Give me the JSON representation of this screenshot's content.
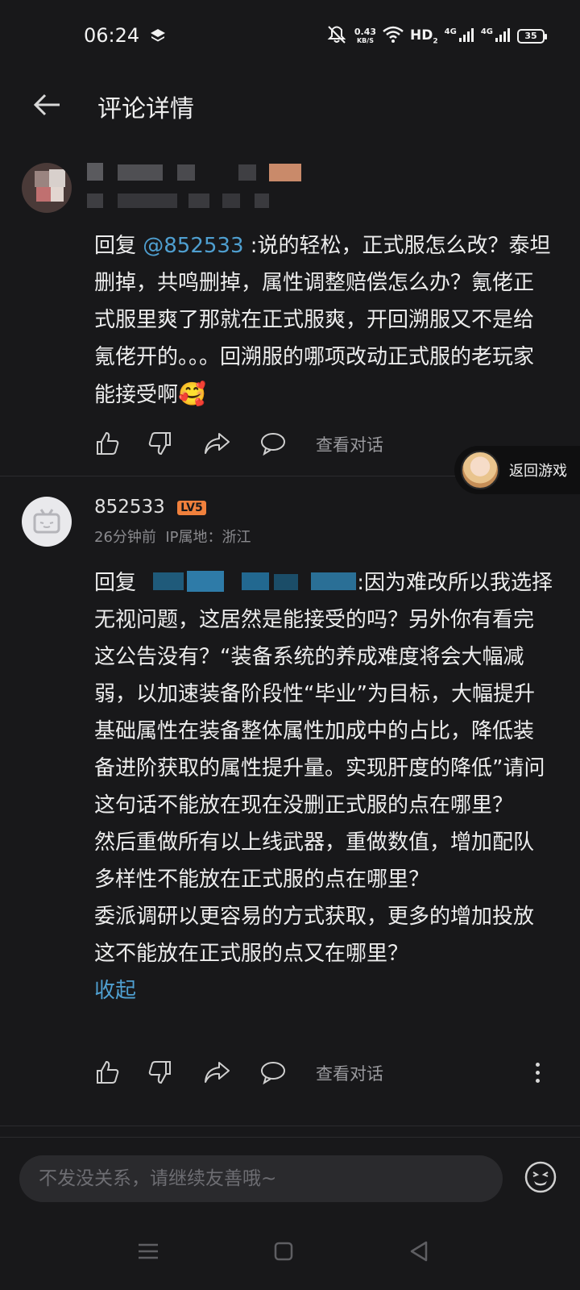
{
  "status_bar": {
    "time": "06:24",
    "net_speed_value": "0.43",
    "net_speed_unit": "KB/S",
    "hd_label": "HD",
    "hd_sub": "2",
    "signal1_label": "4G",
    "signal2_label": "4G",
    "battery": "35"
  },
  "header": {
    "title": "评论详情"
  },
  "comment1": {
    "reply_prefix": "回复 ",
    "mention": "@852533",
    "text": " :说的轻松，正式服怎么改？泰坦删掉，共鸣删掉，属性调整赔偿怎么办？氪佬正式服里爽了那就在正式服爽，开回溯服又不是给氪佬开的。。。回溯服的哪项改动正式服的老玩家能接受啊",
    "emoji": "🥰",
    "view_dialog": "查看对话"
  },
  "comment2": {
    "username": "852533",
    "level_badge": "LV5",
    "time": "26分钟前",
    "ip_location": "IP属地：浙江",
    "reply_prefix": "回复 ",
    "text": ":因为难改所以我选择无视问题，这居然是能接受的吗？另外你有看完这公告没有？“装备系统的养成难度将会大幅减弱，以加速装备阶段性“毕业”为目标，大幅提升基础属性在装备整体属性加成中的占比，降低装备进阶获取的属性提升量。实现肝度的降低”请问这句话不能放在现在没删正式服的点在哪里？",
    "text_p2": "然后重做所有以上线武器，重做数值，增加配队多样性不能放在正式服的点在哪里？",
    "text_p3": "委派调研以更容易的方式获取，更多的增加投放这不能放在正式服的点又在哪里？",
    "collapse": "收起",
    "view_dialog": "查看对话"
  },
  "float_button": {
    "label": "返回游戏"
  },
  "input": {
    "placeholder": "不发没关系，请继续友善哦~"
  },
  "colors": {
    "background": "#18181a",
    "link": "#4f9fd0",
    "level_badge": "#f0803c"
  }
}
